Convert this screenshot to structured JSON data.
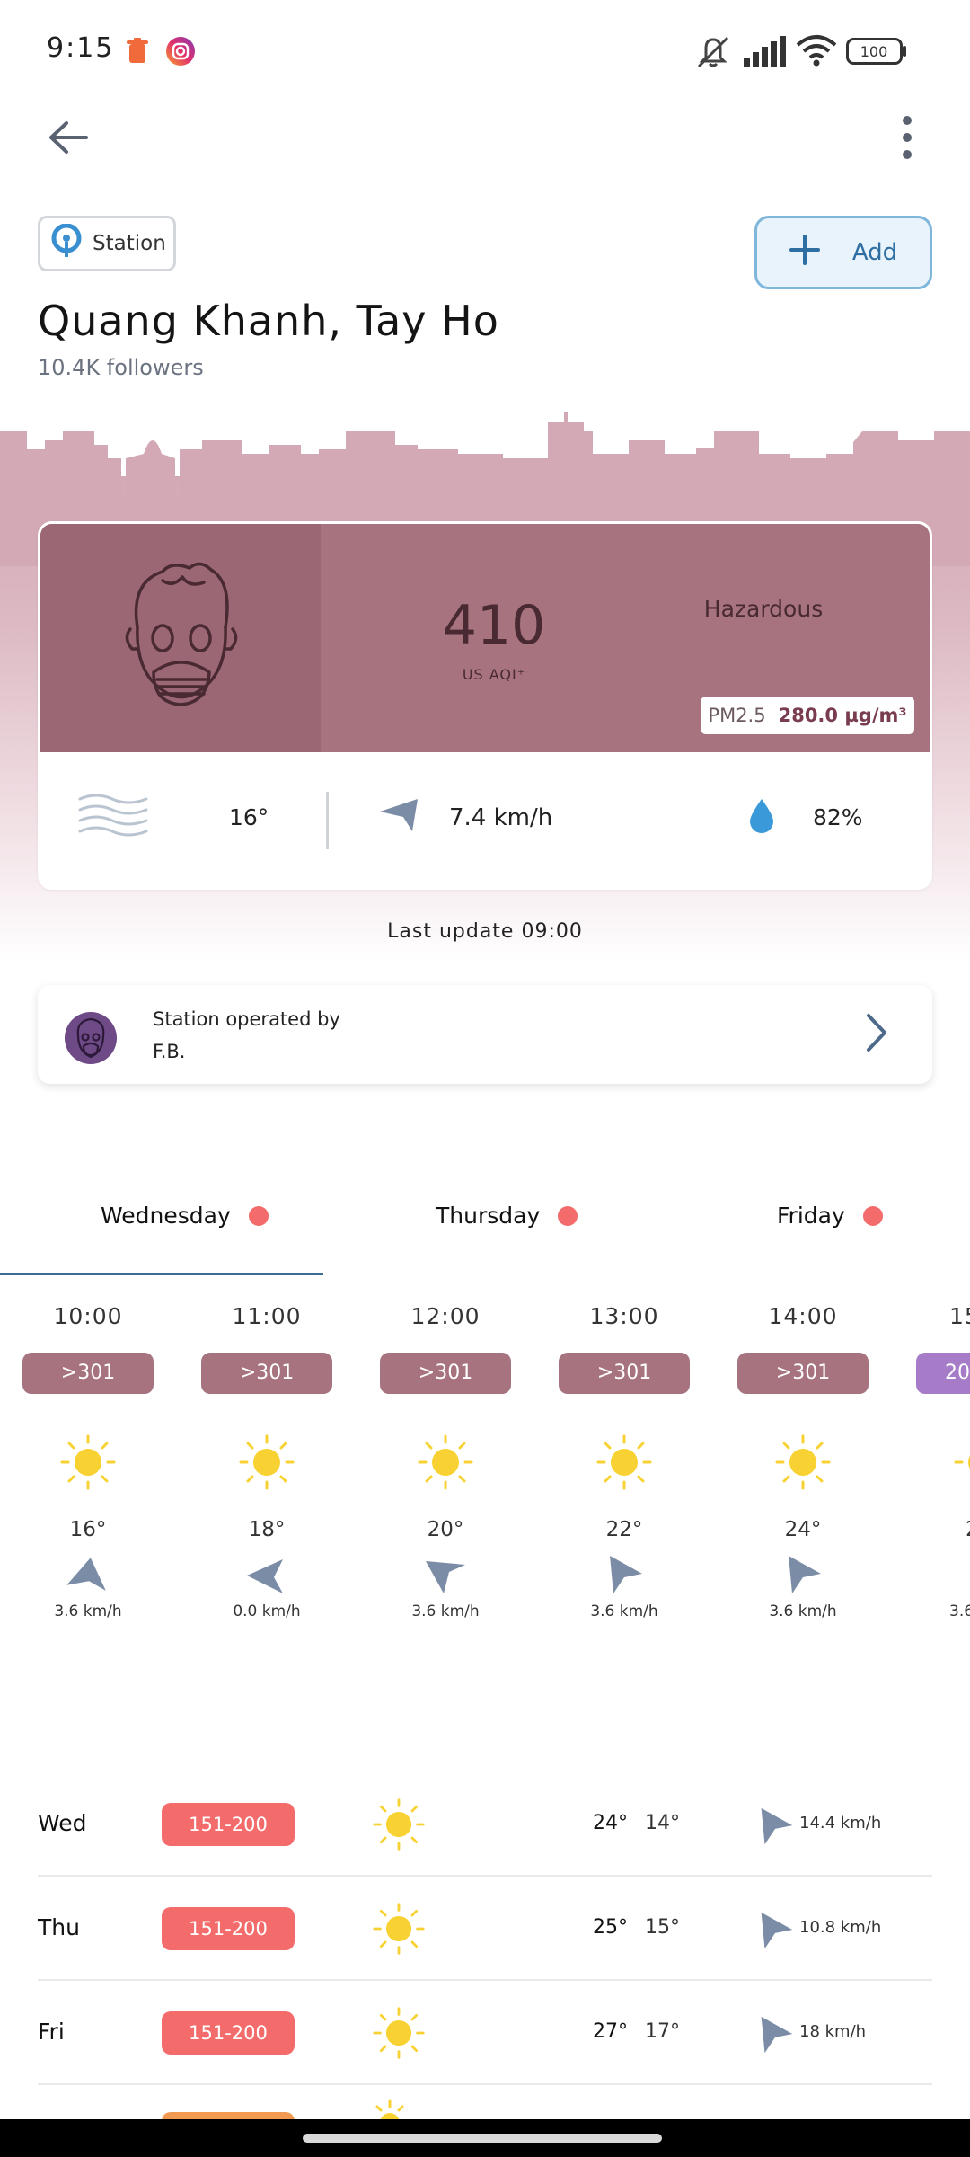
{
  "status_bar": {
    "time": "9:15",
    "battery": "100"
  },
  "station": {
    "chip_label": "Station",
    "add_label": "Add",
    "name": "Quang Khanh, Tay Ho",
    "followers": "10.4K followers"
  },
  "aqi": {
    "value": "410",
    "unit": "US AQI⁺",
    "level": "Hazardous",
    "pollutant_label": "PM2.5",
    "pollutant_value": "280.0 µg/m³",
    "color": "#a6737f"
  },
  "weather": {
    "temperature": "16°",
    "wind": "7.4 km/h",
    "humidity": "82%"
  },
  "last_update": "Last update 09:00",
  "operator": {
    "title": "Station operated by",
    "name": "F.B."
  },
  "day_tabs": [
    {
      "label": "Wednesday"
    },
    {
      "label": "Thursday"
    },
    {
      "label": "Friday"
    }
  ],
  "hourly": [
    {
      "time": "10:00",
      "aqi": ">301",
      "temp": "16°",
      "wind": "3.6 km/h"
    },
    {
      "time": "11:00",
      "aqi": ">301",
      "temp": "18°",
      "wind": "0.0 km/h"
    },
    {
      "time": "12:00",
      "aqi": ">301",
      "temp": "20°",
      "wind": "3.6 km/h"
    },
    {
      "time": "13:00",
      "aqi": ">301",
      "temp": "22°",
      "wind": "3.6 km/h"
    },
    {
      "time": "14:00",
      "aqi": ">301",
      "temp": "24°",
      "wind": "3.6 km/h"
    },
    {
      "time": "15",
      "aqi": "20",
      "temp": "2",
      "wind": "3.6"
    }
  ],
  "daily": [
    {
      "day": "Wed",
      "aqi": "151-200",
      "high": "24°",
      "low": "14°",
      "wind": "14.4 km/h"
    },
    {
      "day": "Thu",
      "aqi": "151-200",
      "high": "25°",
      "low": "15°",
      "wind": "10.8 km/h"
    },
    {
      "day": "Fri",
      "aqi": "151-200",
      "high": "27°",
      "low": "17°",
      "wind": "18 km/h"
    }
  ],
  "icons": {
    "back": "arrow-left-icon",
    "more": "more-vertical-icon",
    "station": "location-pin-icon",
    "add": "plus-icon",
    "mask_face": "gas-mask-face-icon",
    "fog": "fog-icon",
    "wind": "wind-arrow-icon",
    "humidity": "water-drop-icon",
    "chevron": "chevron-right-icon",
    "sun": "sun-icon"
  }
}
